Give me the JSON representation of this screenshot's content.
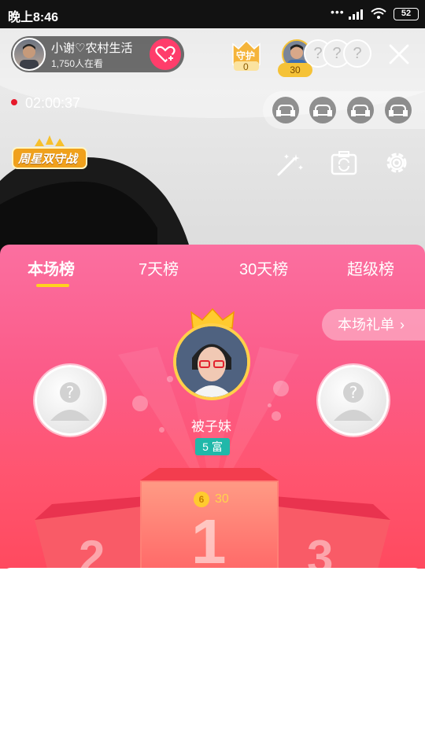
{
  "status_bar": {
    "time": "晚上8:46",
    "battery": "52"
  },
  "host": {
    "name": "小谢♡农村生活",
    "viewers": "1,750人在看"
  },
  "guard": {
    "label": "守护",
    "count": "0"
  },
  "audience": {
    "count": "30"
  },
  "live": {
    "timer": "02:00:37"
  },
  "badge": {
    "text": "周星双守战"
  },
  "tabs": [
    {
      "label": "本场榜",
      "active": true
    },
    {
      "label": "7天榜",
      "active": false
    },
    {
      "label": "30天榜",
      "active": false
    },
    {
      "label": "超级榜",
      "active": false
    }
  ],
  "gift_list_button": "本场礼单",
  "first_place": {
    "name": "被子妹",
    "level": "5",
    "level_suffix": "富",
    "coin_icon": "6",
    "score": "30"
  },
  "podium": {
    "first": "1",
    "second": "2",
    "third": "3"
  },
  "colors": {
    "accent": "#ff3d6b",
    "tab_underline": "#ffd21e",
    "level_badge": "#20b8a9",
    "score": "#ffd34d"
  }
}
